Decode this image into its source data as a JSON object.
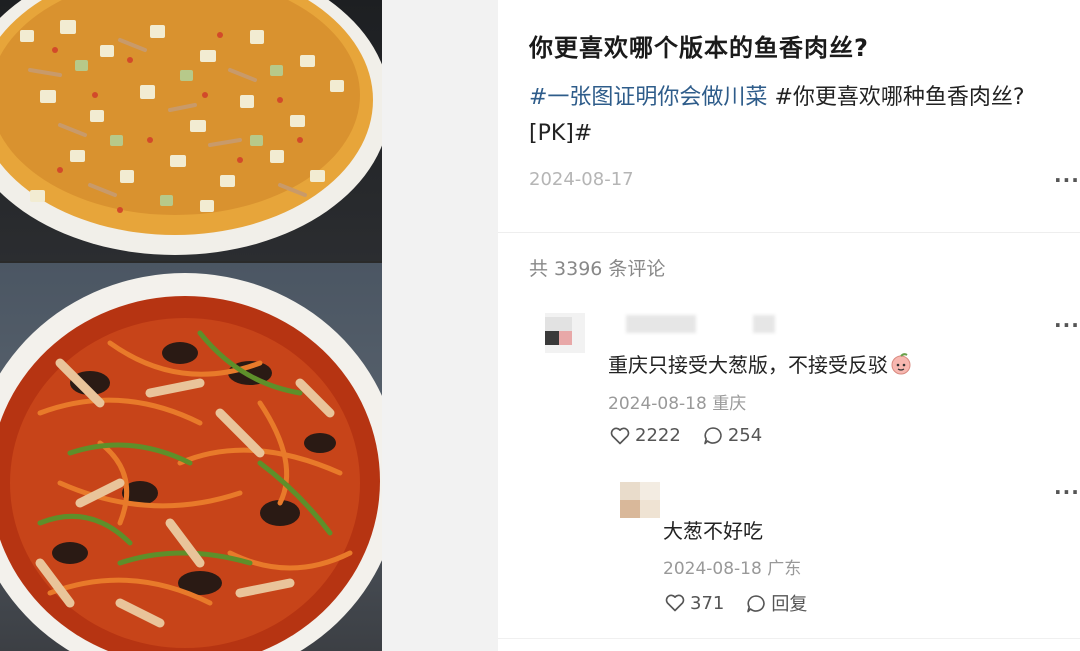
{
  "post": {
    "title": "你更喜欢哪个版本的鱼香肉丝?",
    "tag1": "#一张图证明你会做川菜",
    "tag2": "#你更喜欢哪种鱼香肉丝?",
    "pk": "[PK]#",
    "date": "2024-08-17",
    "more": "···"
  },
  "comments_header": {
    "count_text": "共 3396 条评论"
  },
  "comments": [
    {
      "text": "重庆只接受大葱版，不接受反驳",
      "emoji": "peach-face-emoji",
      "date": "2024-08-18",
      "location": "重庆",
      "likes": "2222",
      "replies": "254",
      "more": "···"
    },
    {
      "text": "大葱不好吃",
      "date": "2024-08-18",
      "location": "广东",
      "likes": "371",
      "reply_label": "回复",
      "more": "···"
    }
  ],
  "images": [
    {
      "name": "dish-photo-scallion-version"
    },
    {
      "name": "dish-photo-classic-version"
    }
  ],
  "colors": {
    "hashtag": "#2e5c8a",
    "muted": "#999999",
    "title": "#1a1a1a"
  }
}
